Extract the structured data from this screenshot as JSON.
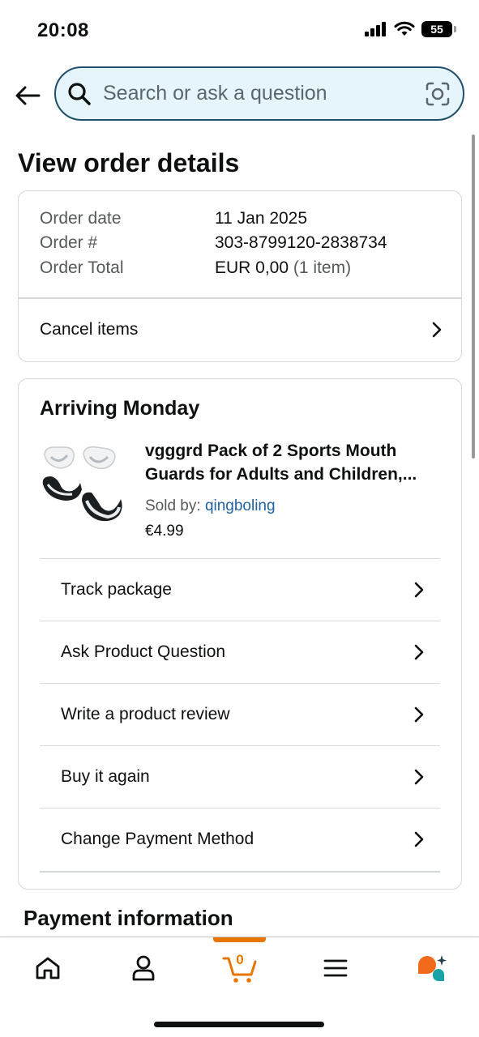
{
  "status_bar": {
    "time": "20:08",
    "battery": "55"
  },
  "search": {
    "placeholder": "Search or ask a question"
  },
  "page": {
    "title": "View order details"
  },
  "order_summary": {
    "rows": [
      {
        "label": "Order date",
        "value": "11 Jan 2025",
        "suffix": ""
      },
      {
        "label": "Order #",
        "value": "303-8799120-2838734",
        "suffix": ""
      },
      {
        "label": "Order Total",
        "value": "EUR 0,00",
        "suffix": "(1 item)"
      }
    ],
    "cancel_label": "Cancel items"
  },
  "shipment": {
    "heading": "Arriving Monday",
    "product": {
      "title": "vgggrd Pack of 2 Sports Mouth Guards for Adults and Children,...",
      "sold_by_label": "Sold by:",
      "seller": "qingboling",
      "price": "€4.99"
    },
    "actions": [
      {
        "label": "Track package"
      },
      {
        "label": "Ask Product Question"
      },
      {
        "label": "Write a product review"
      },
      {
        "label": "Buy it again"
      },
      {
        "label": "Change Payment Method"
      }
    ]
  },
  "payment": {
    "title": "Payment information"
  },
  "bottom_nav": {
    "items": [
      {
        "name": "home",
        "icon": "home-icon"
      },
      {
        "name": "account",
        "icon": "person-icon"
      },
      {
        "name": "cart",
        "icon": "cart-icon",
        "count": "0",
        "active": true
      },
      {
        "name": "menu",
        "icon": "menu-icon"
      },
      {
        "name": "rufus",
        "icon": "chat-assistant-icon"
      }
    ]
  },
  "colors": {
    "accent": "#e77600",
    "link": "#2162a1",
    "search_border": "#1f4f6a",
    "search_bg": "#e6f5fb"
  }
}
